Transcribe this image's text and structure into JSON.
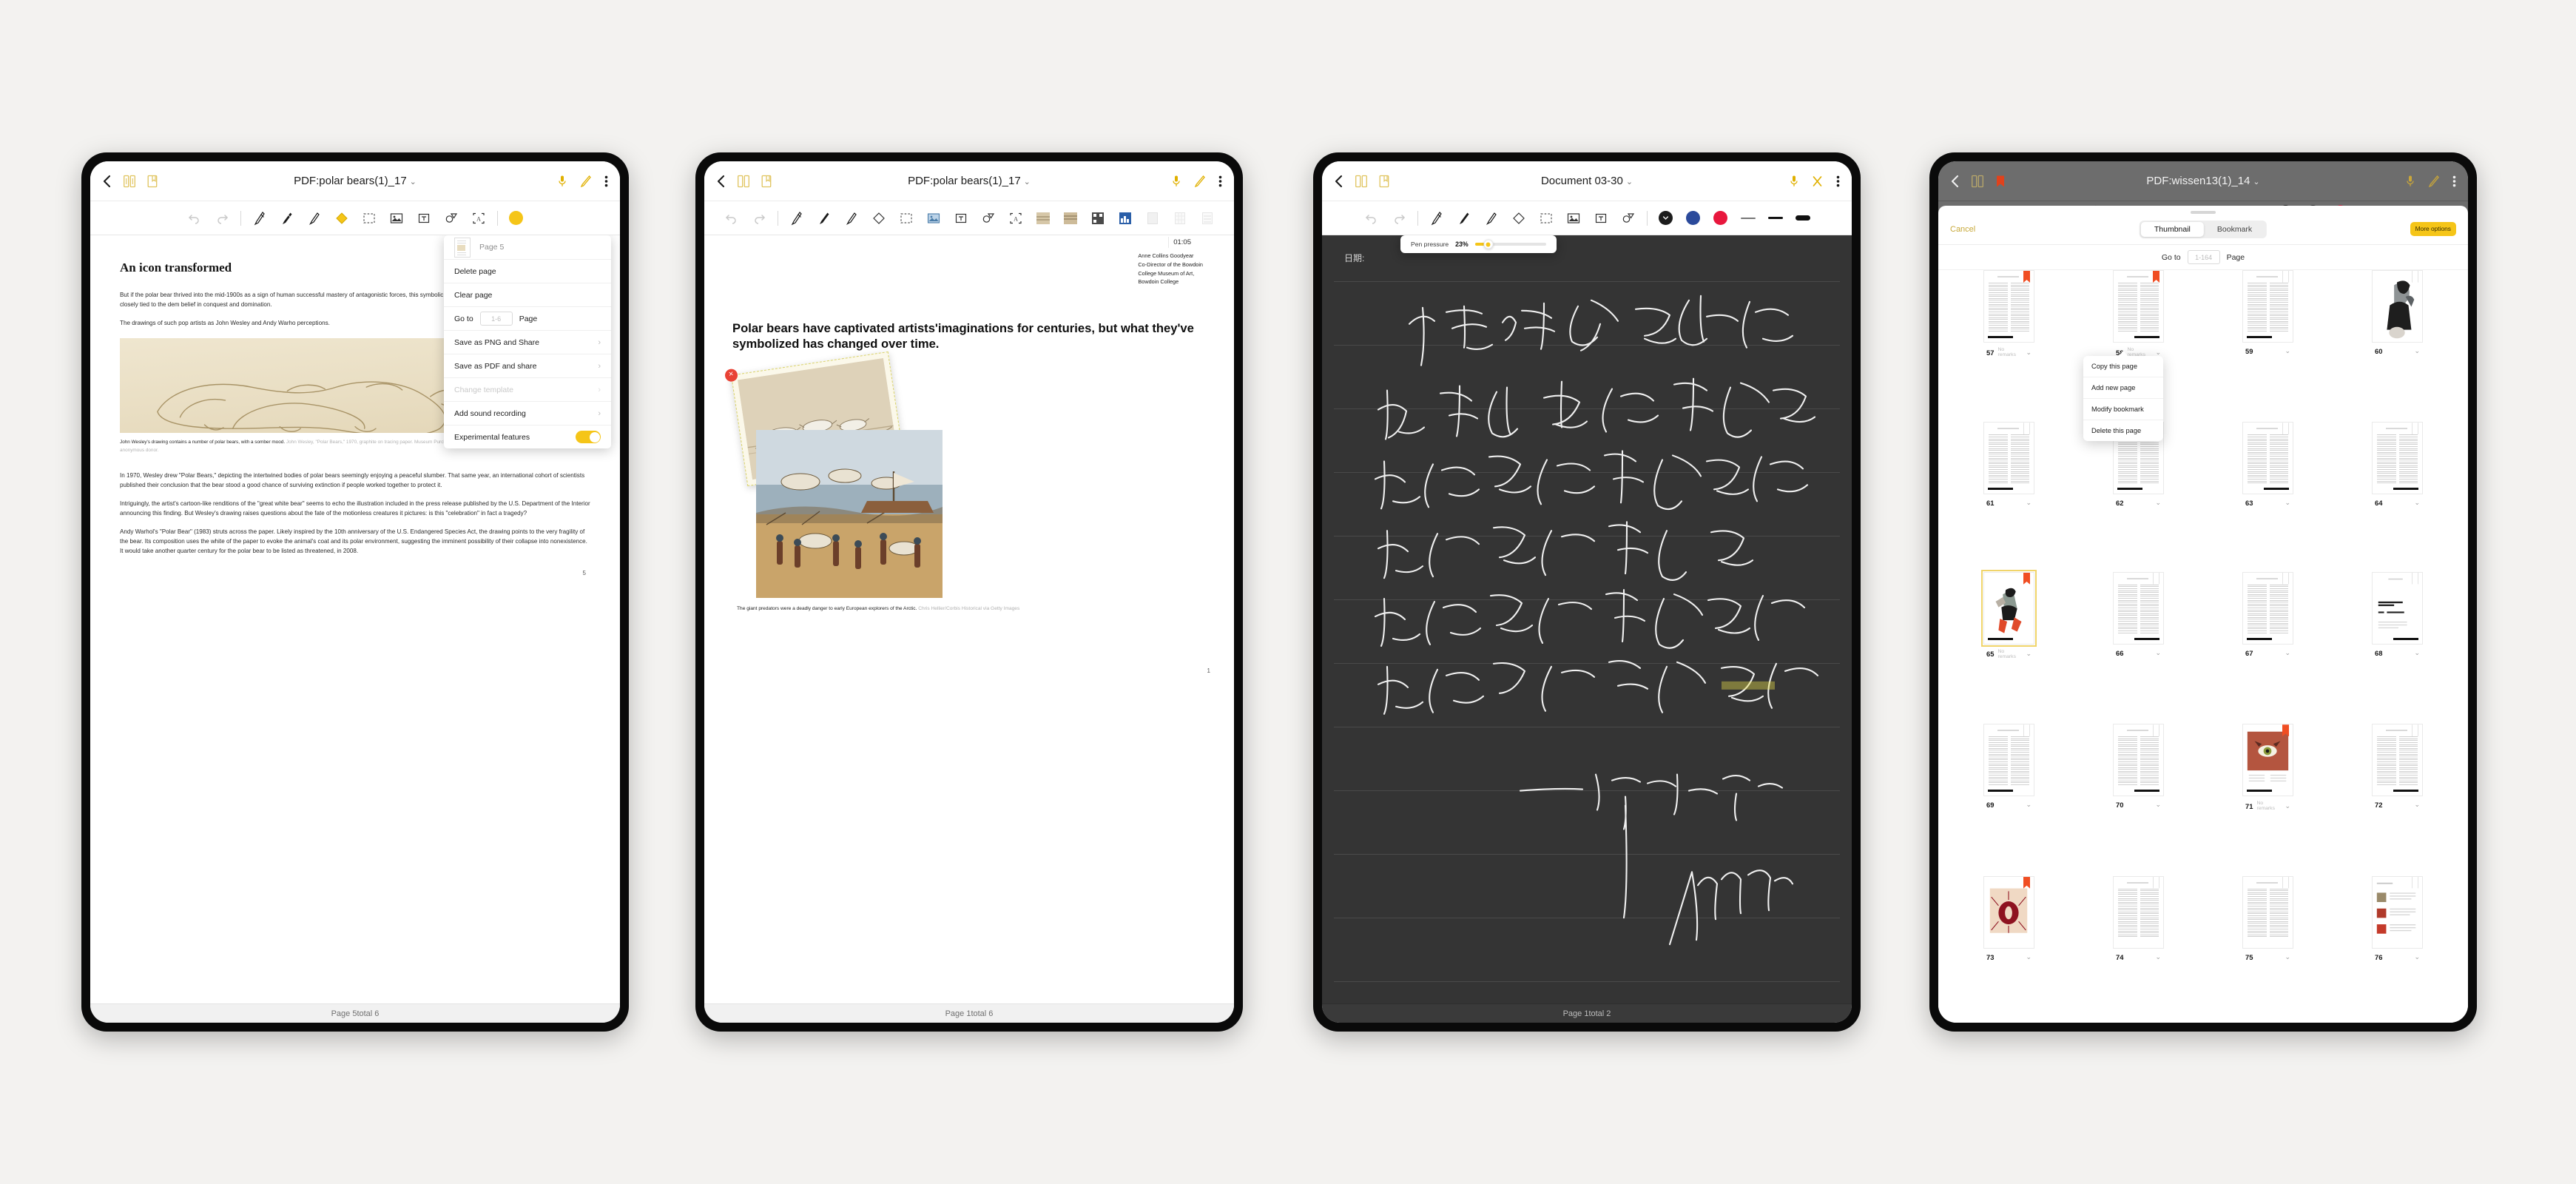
{
  "tablets": [
    {
      "id": "tablet-pdf-menu",
      "appbar": {
        "back_icon": "chevron-left-icon",
        "grid_icon": "page-layout-icon",
        "bookmark_icon": "bookmark-icon",
        "title": "PDF:polar bears(1)_17",
        "title_caret": "⌄",
        "mic_icon": "microphone-icon",
        "pen_icon": "pen-icon",
        "more_icon": "overflow-menu-icon"
      },
      "toolbar": {
        "undo": "undo-icon",
        "redo": "redo-icon",
        "tools": [
          "fountain-pen-icon",
          "ballpoint-pen-icon",
          "marker-icon",
          "highlighter-icon",
          "lasso-select-icon",
          "insert-image-icon",
          "text-box-icon",
          "shape-icon",
          "ocr-icon"
        ]
      },
      "document": {
        "heading": "An icon transformed",
        "paragraphs": [
          "But if the polar bear thrived into the mid-1900s as a sign of human successful mastery of antagonistic forces, this symbolic association 20th century. Today's polar bears are more closely tied to the dem belief in conquest and domination.",
          "The drawings of such pop artists as John Wesley and Andy Warho perceptions."
        ],
        "figure_caption_text": "John Wesley's drawing contains a number of polar bears, with a somber mood.",
        "figure_caption_credit": "John Wesley, \"Polar Bears,\" 1970, graphite on tracing paper. Museum Purchase, acquired through the generosity of Eric Silverman '85 and an anonymous donor.",
        "body": [
          "In 1970, Wesley drew \"Polar Bears,\" depicting the intertwined bodies of polar bears seemingly enjoying a peaceful slumber. That same year, an international cohort of scientists published their conclusion that the bear stood a good chance of surviving extinction if people worked together to protect it.",
          "Intriguingly, the artist's cartoon-like renditions of the \"great white bear\" seems to echo the illustration included in the press release published by the U.S. Department of the Interior announcing this finding. But Wesley's drawing raises questions about the fate of the motionless creatures it pictures: is this \"celebration\" in fact a tragedy?",
          "Andy Warhol's \"Polar Bear\" (1983) struts across the paper. Likely inspired by the 10th anniversary of the U.S. Endangered Species Act, the drawing points to the very fragility of the bear. Its composition uses the white of the paper to evoke the animal's coat and its polar environment, suggesting the imminent possibility of their collapse into nonexistence. It would take another quarter century for the polar bear to be listed as threatened, in 2008."
        ],
        "page_number": "5"
      },
      "menu": {
        "thumb_label": "Page 5",
        "items": [
          {
            "label": "Delete page",
            "chevron": false,
            "disabled": false
          },
          {
            "label": "Clear page",
            "chevron": false,
            "disabled": false
          }
        ],
        "goto_prefix": "Go to",
        "goto_placeholder": "1-6",
        "goto_suffix": "Page",
        "items2": [
          {
            "label": "Save as PNG and Share",
            "chevron": true,
            "disabled": false
          },
          {
            "label": "Save as PDF and share",
            "chevron": true,
            "disabled": false
          },
          {
            "label": "Change template",
            "chevron": true,
            "disabled": true
          },
          {
            "label": "Add sound recording",
            "chevron": true,
            "disabled": false
          }
        ],
        "toggle_label": "Experimental features",
        "toggle_on": true,
        "toggle_color": "#f5c518"
      },
      "status": "Page 5total 6"
    },
    {
      "id": "tablet-pdf-image-edit",
      "appbar": {
        "title": "PDF:polar bears(1)_17",
        "title_caret": "⌄"
      },
      "recording_timestamp": "01:05",
      "document": {
        "byline": [
          "Anne Collins Goodyear",
          "Co-Director of the Bowdoin",
          "College Museum of Art,",
          "Bowdoin College"
        ],
        "headline": "Polar bears have captivated artists'imaginations for centuries, but what they've symbolized has changed over time.",
        "caption_text": "The giant predators were a deadly danger to early European explorers of the Arctic.",
        "caption_credit": "Chris Hellier/Corbis Historical via Getty Images",
        "page_number": "1",
        "delete_badge": "×"
      },
      "status": "Page 1total 6"
    },
    {
      "id": "tablet-handwriting-note",
      "appbar": {
        "title": "Document 03-30",
        "title_caret": "⌄",
        "mic_icon": "microphone-icon",
        "close_icon": "close-x-icon",
        "more_icon": "overflow-menu-icon"
      },
      "colors": [
        {
          "name": "black",
          "hex": "#1c1c1c",
          "selected": true
        },
        {
          "name": "blue",
          "hex": "#2b4a9b",
          "selected": false
        },
        {
          "name": "red",
          "hex": "#e8173d",
          "selected": false
        }
      ],
      "pen_popup": {
        "label": "Pen pressure",
        "value": "23%",
        "percent": 23,
        "accent": "#f5c518"
      },
      "note": {
        "date_label": "日期:",
        "lines": [
          "大江东去，浪淘尽，千古风流人",
          "物。故垒西边，人道是，三国周郎",
          "赤壁。乱石穿空，惊涛拍岸，卷起千",
          "堆雪。江山如画，一时多少豪杰。",
          "遥想公瑾当年，小乔初嫁了，雄姿英发",
          "羽扇纶巾，谈笑间，樯橹灰飞烟灭。",
          "一二零二四年十月二十八日。"
        ],
        "signature": "Mom·fine"
      },
      "status": "Page 1total 2"
    },
    {
      "id": "tablet-thumbnail-browser",
      "appbar": {
        "title": "PDF:wissen13(1)_14",
        "title_caret": "⌄"
      },
      "panel": {
        "cancel_label": "Cancel",
        "tabs": [
          {
            "label": "Thumbnail",
            "active": true
          },
          {
            "label": "Bookmark",
            "active": false
          }
        ],
        "more_options_label": "More options",
        "more_options_color": "#f5c518",
        "goto_prefix": "Go to",
        "goto_placeholder": "1-164",
        "goto_suffix": "Page"
      },
      "thumbnails": [
        {
          "num": "57",
          "remark": "No remarks",
          "bookmark": true,
          "kind": "text",
          "bar": "left",
          "selected": false
        },
        {
          "num": "58",
          "remark": "No remarks",
          "bookmark": true,
          "kind": "text",
          "bar": "right",
          "selected": false
        },
        {
          "num": "59",
          "remark": "",
          "bookmark": false,
          "kind": "text",
          "bar": "left",
          "selected": false
        },
        {
          "num": "60",
          "remark": "",
          "bookmark": false,
          "kind": "art-gray",
          "bar": "none",
          "selected": false
        },
        {
          "num": "61",
          "remark": "",
          "bookmark": false,
          "kind": "text",
          "bar": "left",
          "selected": false
        },
        {
          "num": "62",
          "remark": "",
          "bookmark": false,
          "kind": "text",
          "bar": "left",
          "selected": false
        },
        {
          "num": "63",
          "remark": "",
          "bookmark": false,
          "kind": "text",
          "bar": "right",
          "selected": false
        },
        {
          "num": "64",
          "remark": "",
          "bookmark": false,
          "kind": "text",
          "bar": "right",
          "selected": false
        },
        {
          "num": "65",
          "remark": "No remarks",
          "bookmark": true,
          "kind": "art-run",
          "bar": "left",
          "selected": true
        },
        {
          "num": "66",
          "remark": "",
          "bookmark": false,
          "kind": "text",
          "bar": "right",
          "selected": false
        },
        {
          "num": "67",
          "remark": "",
          "bookmark": false,
          "kind": "text",
          "bar": "left",
          "selected": false
        },
        {
          "num": "68",
          "remark": "",
          "bookmark": false,
          "kind": "title",
          "bar": "right",
          "selected": false
        },
        {
          "num": "69",
          "remark": "",
          "bookmark": false,
          "kind": "text",
          "bar": "left",
          "selected": false
        },
        {
          "num": "70",
          "remark": "",
          "bookmark": false,
          "kind": "text",
          "bar": "right",
          "selected": false
        },
        {
          "num": "71",
          "remark": "No remarks",
          "bookmark": true,
          "kind": "art-eye",
          "bar": "left",
          "selected": false
        },
        {
          "num": "72",
          "remark": "",
          "bookmark": false,
          "kind": "text",
          "bar": "right",
          "selected": false
        },
        {
          "num": "73",
          "remark": "",
          "bookmark": true,
          "kind": "art-red",
          "bar": "none",
          "selected": false
        },
        {
          "num": "74",
          "remark": "",
          "bookmark": false,
          "kind": "text",
          "bar": "none",
          "selected": false
        },
        {
          "num": "75",
          "remark": "",
          "bookmark": false,
          "kind": "text",
          "bar": "none",
          "selected": false
        },
        {
          "num": "76",
          "remark": "",
          "bookmark": false,
          "kind": "list",
          "bar": "none",
          "selected": false
        }
      ],
      "context_menu": {
        "items": [
          "Copy this page",
          "Add new page",
          "Modify bookmark",
          "Delete this page"
        ]
      }
    }
  ]
}
